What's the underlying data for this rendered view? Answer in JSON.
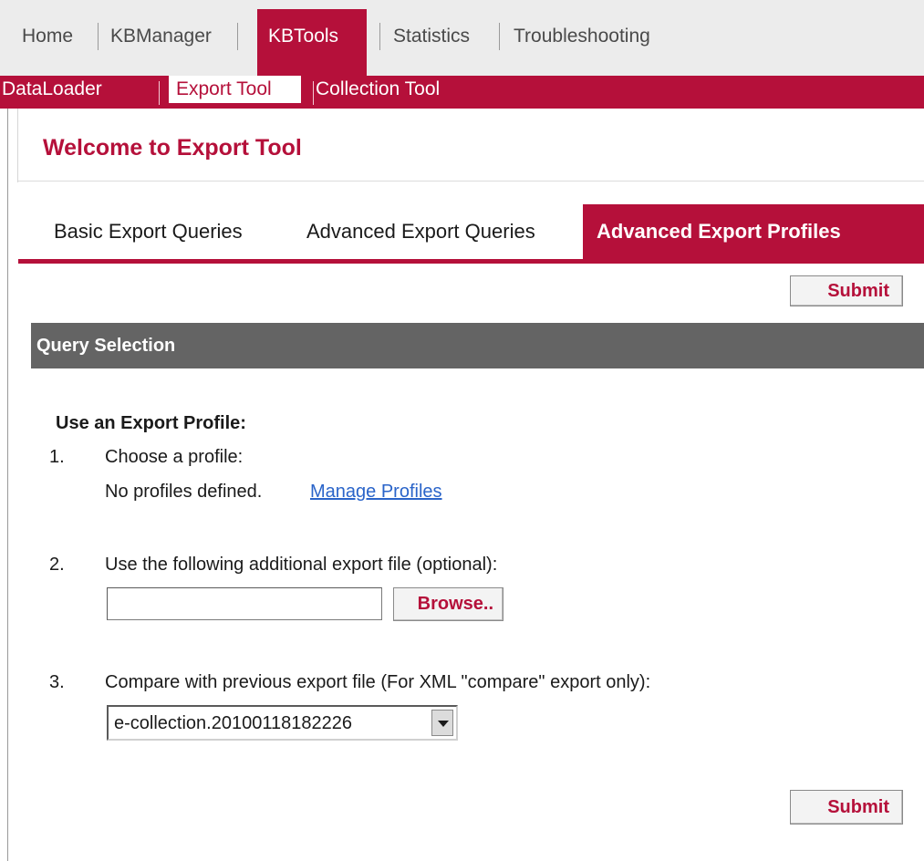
{
  "topnav": {
    "home": "Home",
    "kbmanager": "KBManager",
    "kbtools": "KBTools",
    "statistics": "Statistics",
    "troubleshooting": "Troubleshooting"
  },
  "subnav": {
    "dataloader": "DataLoader",
    "export_tool": "Export Tool",
    "collection_tool": "Collection Tool"
  },
  "page": {
    "title": "Welcome to Export Tool"
  },
  "tabs": [
    {
      "label": "Basic Export Queries",
      "active": false
    },
    {
      "label": "Advanced Export Queries",
      "active": false
    },
    {
      "label": "Advanced Export Profiles",
      "active": true
    }
  ],
  "buttons": {
    "submit_top": "Submit",
    "submit_bottom": "Submit",
    "browse": "Browse.."
  },
  "section": {
    "title": "Query Selection"
  },
  "form": {
    "heading": "Use an Export Profile:",
    "step1": {
      "num": "1.",
      "label": "Choose a profile:",
      "note": "No profiles defined.",
      "link": "Manage Profiles"
    },
    "step2": {
      "num": "2.",
      "label": "Use the following additional export file (optional):",
      "file_value": ""
    },
    "step3": {
      "num": "3.",
      "label": "Compare with previous export file (For XML \"compare\" export only):",
      "selected": "e-collection.20100118182226"
    }
  },
  "colors": {
    "brand": "#b5103a",
    "section_bar": "#646464",
    "link": "#2a64c9"
  }
}
